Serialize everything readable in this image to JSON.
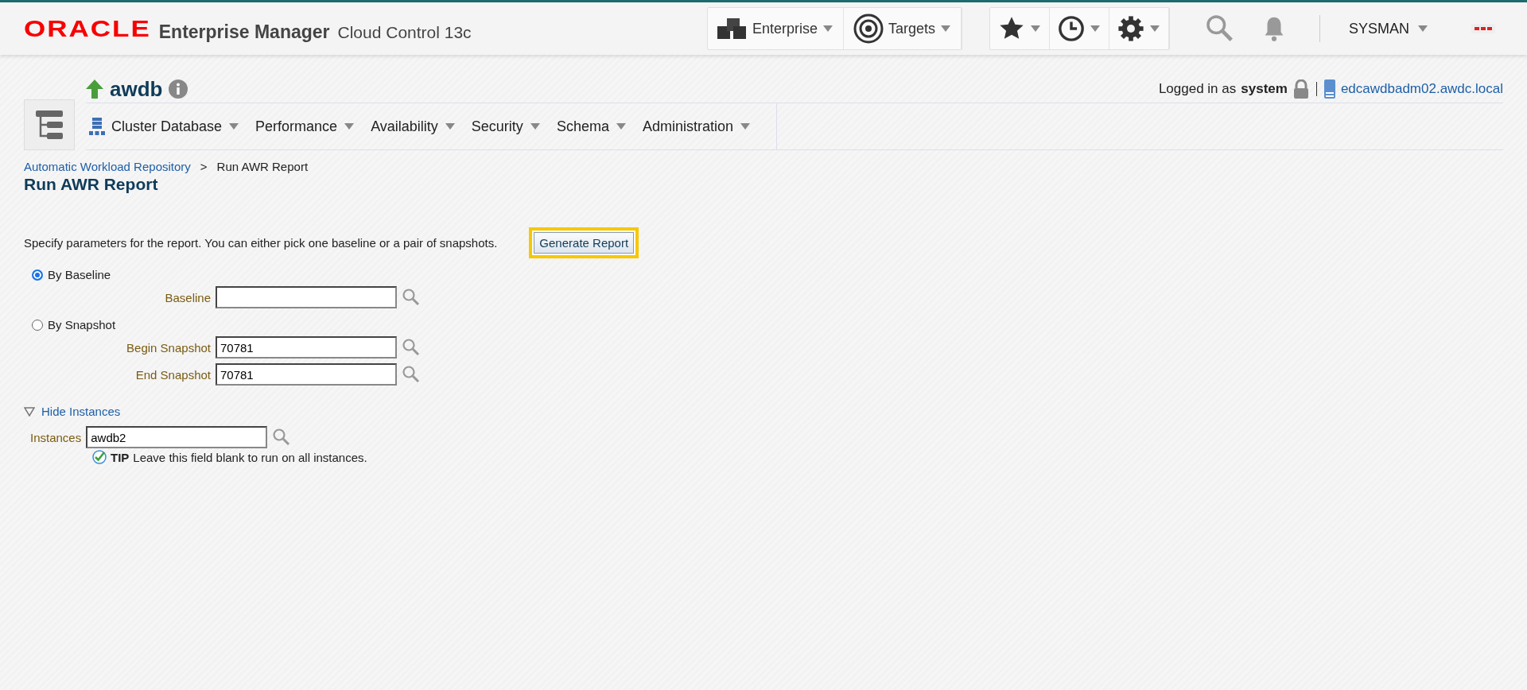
{
  "header": {
    "logo": "ORACLE",
    "product": "Enterprise Manager",
    "edition": "Cloud Control 13c",
    "nav": [
      {
        "kind": "enterprise",
        "label": "Enterprise"
      },
      {
        "kind": "targets",
        "label": "Targets"
      }
    ],
    "tools": [
      {
        "kind": "star"
      },
      {
        "kind": "clock"
      },
      {
        "kind": "gear"
      }
    ],
    "user": "SYSMAN"
  },
  "target": {
    "name": "awdb",
    "up": true,
    "login_prefix": "Logged in as",
    "login_user": "system",
    "host": "edcawdbadm02.awdc.local",
    "menus": [
      "Cluster Database",
      "Performance",
      "Availability",
      "Security",
      "Schema",
      "Administration"
    ]
  },
  "breadcrumb": {
    "link": "Automatic Workload Repository",
    "separator": ">",
    "current": "Run AWR Report"
  },
  "page_title": "Run AWR Report",
  "instructions": "Specify parameters for the report. You can either pick one baseline or a pair of snapshots.",
  "generate_button": {
    "label": "Generate Report",
    "focused": true
  },
  "options": [
    {
      "label": "By Baseline",
      "selected": true,
      "fields": [
        {
          "label": "Baseline"
        }
      ]
    },
    {
      "label": "By Snapshot",
      "selected": false,
      "fields": [
        {
          "label": "Begin Snapshot",
          "value": "70781"
        },
        {
          "label": "End Snapshot",
          "value": "70781"
        }
      ]
    }
  ],
  "instances": {
    "toggle": "Hide Instances",
    "expanded": true,
    "label": "Instances",
    "value": "awdb2",
    "tip_label": "TIP",
    "tip": "Leave this field blank to run on all instances."
  }
}
